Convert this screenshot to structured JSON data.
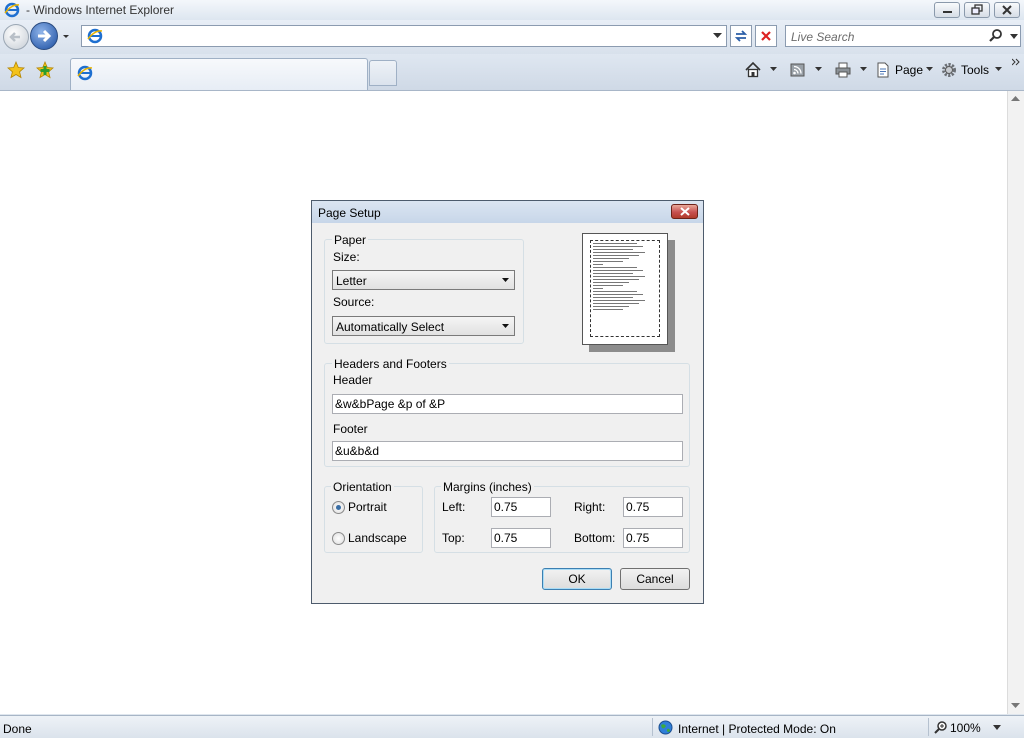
{
  "window": {
    "title": "- Windows Internet Explorer"
  },
  "address_bar": {
    "value": ""
  },
  "search": {
    "placeholder": "Live Search"
  },
  "command_bar": {
    "page_label": "Page",
    "tools_label": "Tools"
  },
  "status_bar": {
    "status": "Done",
    "zone": "Internet | Protected Mode: On",
    "zoom": "100%"
  },
  "dialog": {
    "title": "Page Setup",
    "paper": {
      "legend": "Paper",
      "size_label": "Size:",
      "size_value": "Letter",
      "source_label": "Source:",
      "source_value": "Automatically Select"
    },
    "headers_footers": {
      "legend": "Headers and Footers",
      "header_label": "Header",
      "header_value": "&w&bPage &p of &P",
      "footer_label": "Footer",
      "footer_value": "&u&b&d"
    },
    "orientation": {
      "legend": "Orientation",
      "portrait": "Portrait",
      "landscape": "Landscape",
      "selected": "Portrait"
    },
    "margins": {
      "legend": "Margins (inches)",
      "left_label": "Left:",
      "left_value": "0.75",
      "right_label": "Right:",
      "right_value": "0.75",
      "top_label": "Top:",
      "top_value": "0.75",
      "bottom_label": "Bottom:",
      "bottom_value": "0.75"
    },
    "ok_label": "OK",
    "cancel_label": "Cancel"
  }
}
